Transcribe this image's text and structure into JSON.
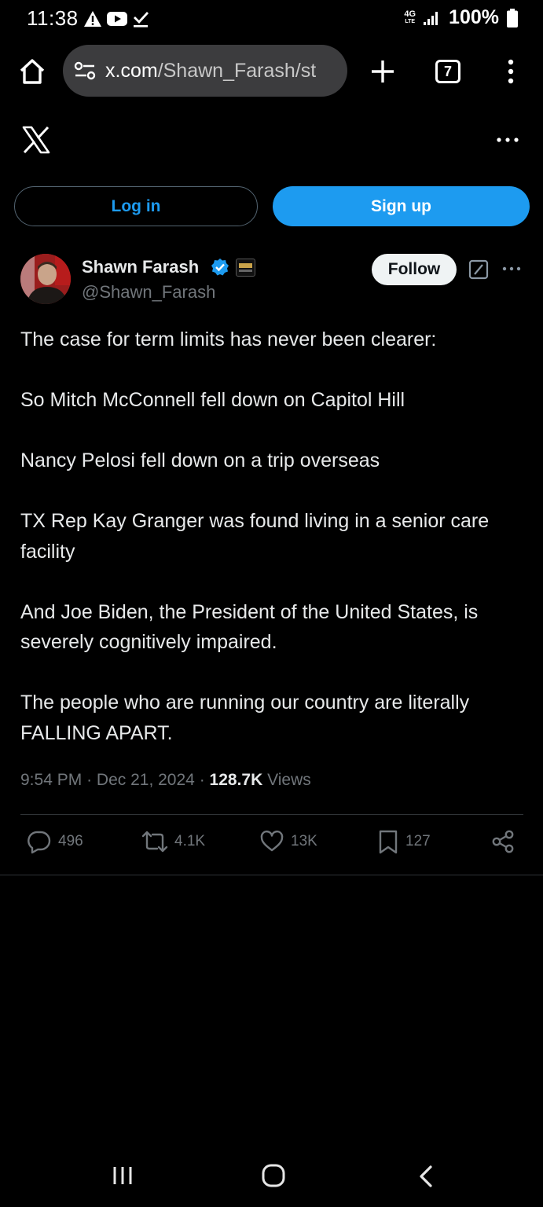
{
  "status_bar": {
    "time": "11:38",
    "network_label_top": "4G",
    "network_label_bottom": "LTE",
    "battery": "100%",
    "notification_icons": [
      "alert-icon",
      "youtube-icon",
      "download-done-icon"
    ]
  },
  "browser": {
    "url_host": "x.com",
    "url_path": "/Shawn_Farash/st",
    "tab_count": "7"
  },
  "x_header": {
    "logo": "x-logo-icon"
  },
  "auth": {
    "login_label": "Log in",
    "signup_label": "Sign up"
  },
  "tweet": {
    "author_name": "Shawn Farash",
    "handle": "@Shawn_Farash",
    "follow_label": "Follow",
    "paragraphs": [
      "The case for term limits has never been clearer:",
      "So Mitch McConnell fell down on Capitol Hill",
      "Nancy Pelosi fell down on a trip overseas",
      "TX Rep Kay Granger was found living in a senior care facility",
      "And Joe Biden, the President of the United States, is severely cognitively impaired.",
      "The people who are running our country are literally FALLING APART."
    ],
    "time": "9:54 PM",
    "separator": "·",
    "date": "Dec 21, 2024",
    "views_count": "128.7K",
    "views_label": "Views",
    "stats": {
      "replies": "496",
      "reposts": "4.1K",
      "likes": "13K",
      "bookmarks": "127"
    }
  },
  "colors": {
    "background": "#000000",
    "accent": "#1d9bf0",
    "text_primary": "#e7e9ea",
    "text_secondary": "#71767b",
    "divider": "#2f3336"
  }
}
